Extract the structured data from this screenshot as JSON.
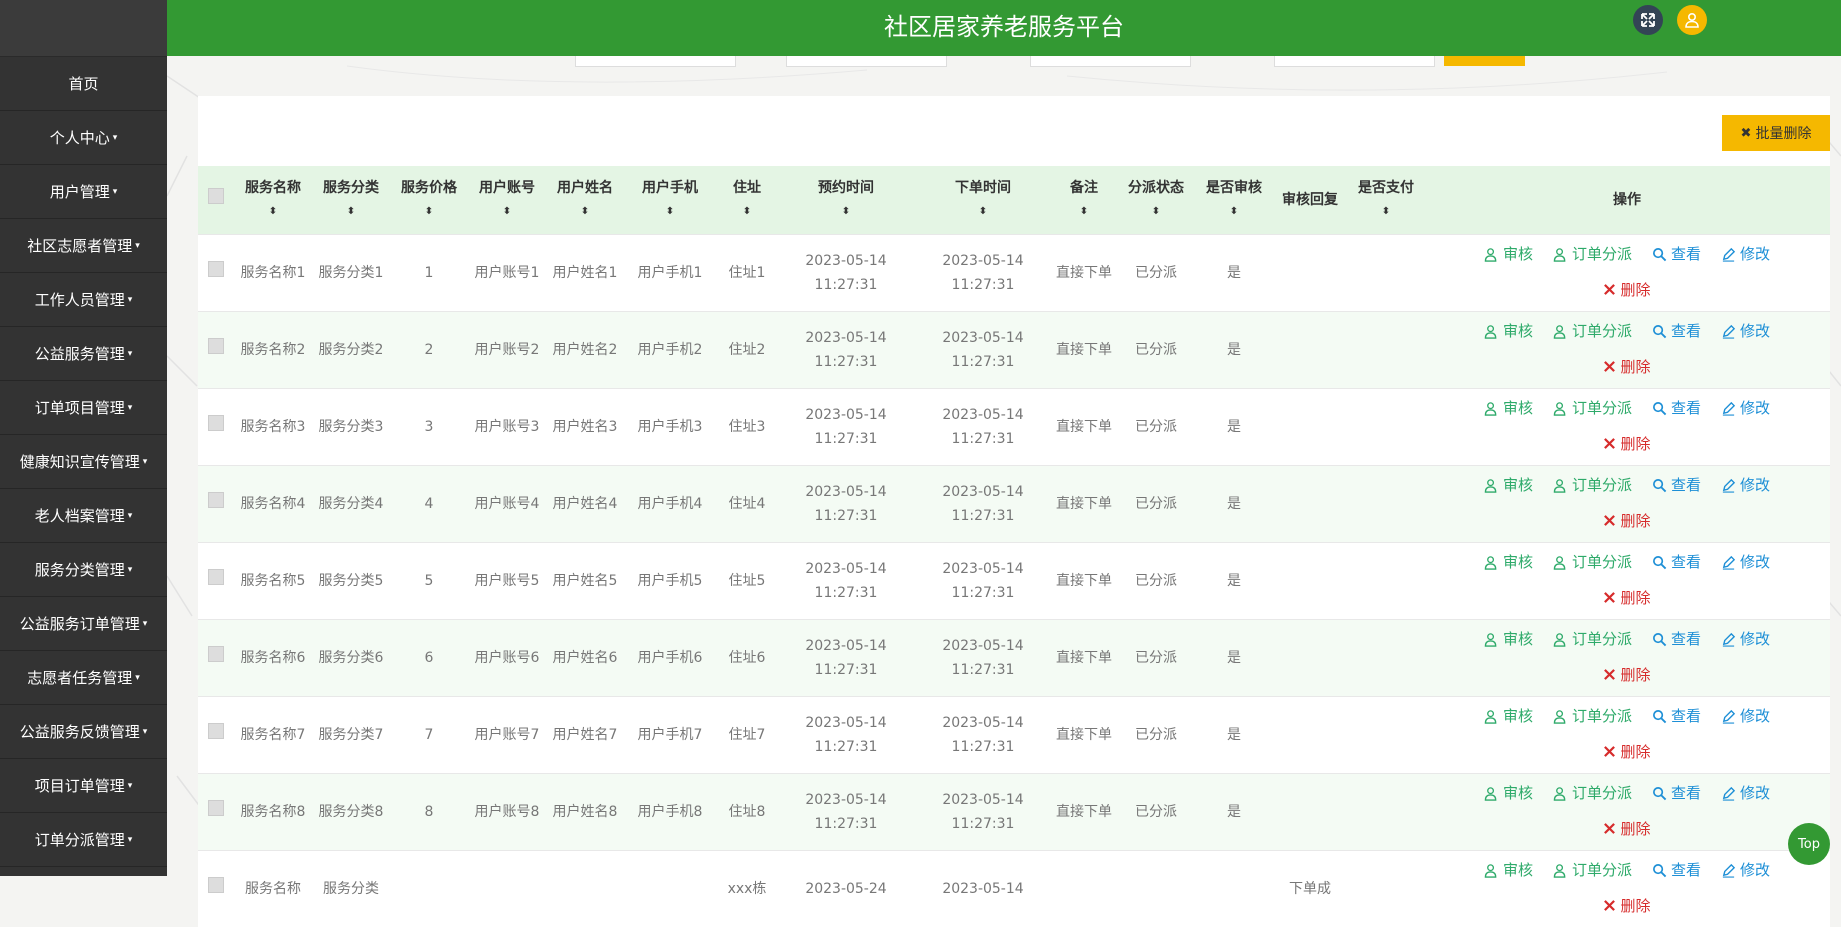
{
  "app": {
    "title": "社区居家养老服务平台"
  },
  "sidebar": {
    "items": [
      {
        "label": "首页",
        "caret": ""
      },
      {
        "label": "个人中心",
        "caret": "▾"
      },
      {
        "label": "用户管理",
        "caret": "▾"
      },
      {
        "label": "社区志愿者管理",
        "caret": "▾"
      },
      {
        "label": "工作人员管理",
        "caret": "▾"
      },
      {
        "label": "公益服务管理",
        "caret": "▾"
      },
      {
        "label": "订单项目管理",
        "caret": "▾"
      },
      {
        "label": "健康知识宣传管理",
        "caret": "▾"
      },
      {
        "label": "老人档案管理",
        "caret": "▾"
      },
      {
        "label": "服务分类管理",
        "caret": "▾"
      },
      {
        "label": "公益服务订单管理",
        "caret": "▾"
      },
      {
        "label": "志愿者任务管理",
        "caret": "▾"
      },
      {
        "label": "公益服务反馈管理",
        "caret": "▾"
      },
      {
        "label": "项目订单管理",
        "caret": "▾"
      },
      {
        "label": "订单分派管理",
        "caret": "▾"
      }
    ]
  },
  "toolbar": {
    "batch_delete": "批量删除",
    "batch_delete_icon": "x-icon"
  },
  "table": {
    "sort_glyph": "⬍",
    "headers": [
      {
        "label": "服务名称",
        "sort": true
      },
      {
        "label": "服务分类",
        "sort": true
      },
      {
        "label": "服务价格",
        "sort": true
      },
      {
        "label": "用户账号",
        "sort": true
      },
      {
        "label": "用户姓名",
        "sort": true
      },
      {
        "label": "用户手机",
        "sort": true
      },
      {
        "label": "住址",
        "sort": true
      },
      {
        "label": "预约时间",
        "sort": true
      },
      {
        "label": "下单时间",
        "sort": true
      },
      {
        "label": "备注",
        "sort": true
      },
      {
        "label": "分派状态",
        "sort": true
      },
      {
        "label": "是否审核",
        "sort": true
      },
      {
        "label": "审核回复",
        "sort": false
      },
      {
        "label": "是否支付",
        "sort": true
      },
      {
        "label": "操作",
        "sort": false
      }
    ],
    "rows": [
      {
        "name": "服务名称1",
        "category": "服务分类1",
        "price": "1",
        "account": "用户账号1",
        "username": "用户姓名1",
        "phone": "用户手机1",
        "address": "住址1",
        "appoint_time": "2023-05-14 11:27:31",
        "order_time": "2023-05-14 11:27:31",
        "remark": "直接下单",
        "dispatch": "已分派",
        "reviewed": "是",
        "reply": "",
        "paid": ""
      },
      {
        "name": "服务名称2",
        "category": "服务分类2",
        "price": "2",
        "account": "用户账号2",
        "username": "用户姓名2",
        "phone": "用户手机2",
        "address": "住址2",
        "appoint_time": "2023-05-14 11:27:31",
        "order_time": "2023-05-14 11:27:31",
        "remark": "直接下单",
        "dispatch": "已分派",
        "reviewed": "是",
        "reply": "",
        "paid": ""
      },
      {
        "name": "服务名称3",
        "category": "服务分类3",
        "price": "3",
        "account": "用户账号3",
        "username": "用户姓名3",
        "phone": "用户手机3",
        "address": "住址3",
        "appoint_time": "2023-05-14 11:27:31",
        "order_time": "2023-05-14 11:27:31",
        "remark": "直接下单",
        "dispatch": "已分派",
        "reviewed": "是",
        "reply": "",
        "paid": ""
      },
      {
        "name": "服务名称4",
        "category": "服务分类4",
        "price": "4",
        "account": "用户账号4",
        "username": "用户姓名4",
        "phone": "用户手机4",
        "address": "住址4",
        "appoint_time": "2023-05-14 11:27:31",
        "order_time": "2023-05-14 11:27:31",
        "remark": "直接下单",
        "dispatch": "已分派",
        "reviewed": "是",
        "reply": "",
        "paid": ""
      },
      {
        "name": "服务名称5",
        "category": "服务分类5",
        "price": "5",
        "account": "用户账号5",
        "username": "用户姓名5",
        "phone": "用户手机5",
        "address": "住址5",
        "appoint_time": "2023-05-14 11:27:31",
        "order_time": "2023-05-14 11:27:31",
        "remark": "直接下单",
        "dispatch": "已分派",
        "reviewed": "是",
        "reply": "",
        "paid": ""
      },
      {
        "name": "服务名称6",
        "category": "服务分类6",
        "price": "6",
        "account": "用户账号6",
        "username": "用户姓名6",
        "phone": "用户手机6",
        "address": "住址6",
        "appoint_time": "2023-05-14 11:27:31",
        "order_time": "2023-05-14 11:27:31",
        "remark": "直接下单",
        "dispatch": "已分派",
        "reviewed": "是",
        "reply": "",
        "paid": ""
      },
      {
        "name": "服务名称7",
        "category": "服务分类7",
        "price": "7",
        "account": "用户账号7",
        "username": "用户姓名7",
        "phone": "用户手机7",
        "address": "住址7",
        "appoint_time": "2023-05-14 11:27:31",
        "order_time": "2023-05-14 11:27:31",
        "remark": "直接下单",
        "dispatch": "已分派",
        "reviewed": "是",
        "reply": "",
        "paid": ""
      },
      {
        "name": "服务名称8",
        "category": "服务分类8",
        "price": "8",
        "account": "用户账号8",
        "username": "用户姓名8",
        "phone": "用户手机8",
        "address": "住址8",
        "appoint_time": "2023-05-14 11:27:31",
        "order_time": "2023-05-14 11:27:31",
        "remark": "直接下单",
        "dispatch": "已分派",
        "reviewed": "是",
        "reply": "",
        "paid": ""
      },
      {
        "name": "服务名称",
        "category": "服务分类",
        "price": "",
        "account": "",
        "username": "",
        "phone": "",
        "address": "xxx栋",
        "appoint_time": "2023-05-24",
        "order_time": "2023-05-14",
        "remark": "",
        "dispatch": "",
        "reviewed": "",
        "reply": "下单成",
        "paid": ""
      }
    ],
    "actions": {
      "review": "审核",
      "dispatch": "订单分派",
      "view": "查看",
      "edit": "修改",
      "delete": "删除"
    }
  },
  "back_to_top": "Top",
  "colors": {
    "header": "#339933",
    "sidebar": "#333333",
    "accent": "#f5b800",
    "action_green": "#2eaa6a",
    "action_blue": "#1d8fd6",
    "action_red": "#d62b2b"
  }
}
